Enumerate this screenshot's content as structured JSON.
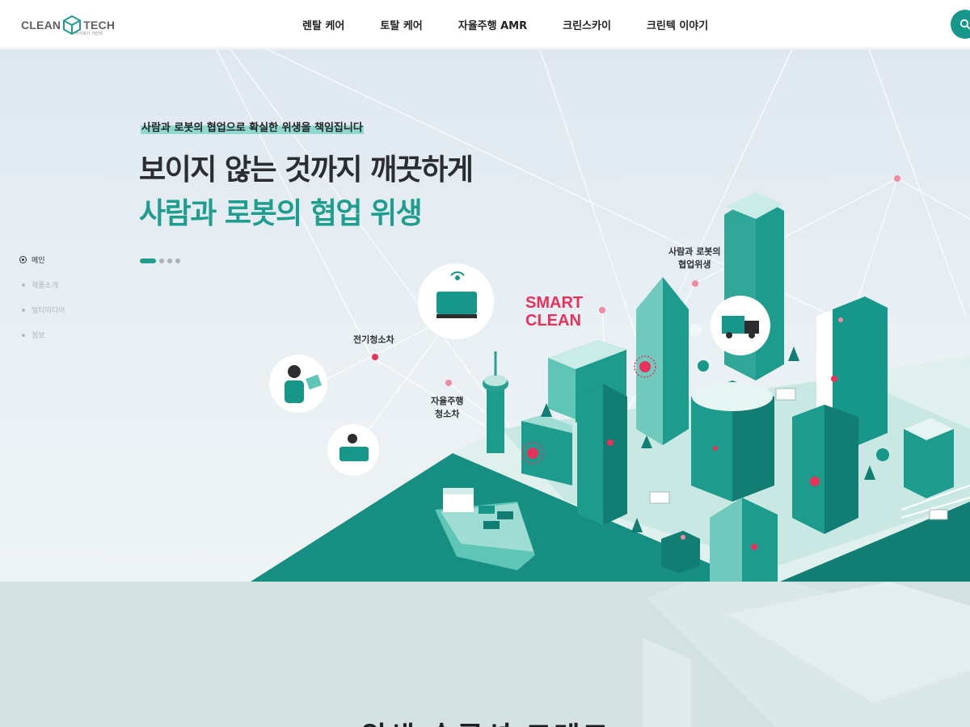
{
  "header": {
    "logo_left": "CLEAN",
    "logo_right": "TECH",
    "logo_sub": "주식회사 크린텍",
    "nav": [
      "렌탈 케어",
      "토탈 케어",
      "자율주행 AMR",
      "크린스카이",
      "크린텍 이야기"
    ],
    "search_icon": "search-icon"
  },
  "hero": {
    "eyebrow": "사람과 로봇의 협업으로 확실한 위생을 책임집니다",
    "title_line1": "보이지 않는 것까지 깨끗하게",
    "title_line2": "사람과 로봇의 협업 위생",
    "slides": {
      "current": 1,
      "total": 4
    },
    "side_nav": [
      "메인",
      "제품소개",
      "멀티미디어",
      "정보"
    ],
    "tags": {
      "electric": "전기청소차",
      "autonomous_1": "자율주행",
      "autonomous_2": "청소차",
      "coop_1": "사람과 로봇의",
      "coop_2": "협업위생"
    },
    "smart_1": "SMART",
    "smart_2": "CLEAN"
  },
  "section": {
    "title": "위생 솔루션 트렌드"
  },
  "colors": {
    "brand": "#1f9e8f",
    "accent": "#e8325a",
    "dark_teal": "#127d72",
    "text": "#2b2d30"
  }
}
